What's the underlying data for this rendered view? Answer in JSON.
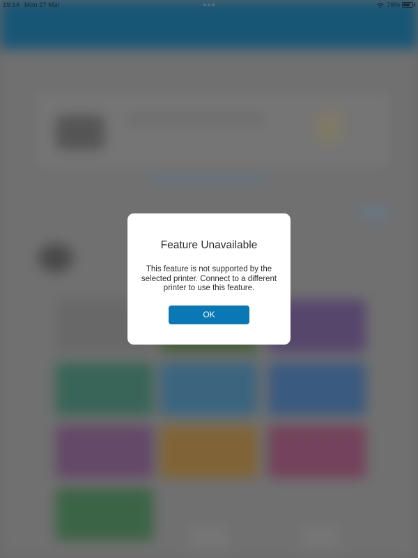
{
  "status_bar": {
    "time": "19:14",
    "date": "Mon 27 Mar",
    "battery_percent_label": "78%",
    "battery_level": 0.78,
    "wifi_icon": "wifi-icon",
    "battery_icon": "battery-icon"
  },
  "alert": {
    "title": "Feature Unavailable",
    "message": "This feature is not supported by the selected printer. Connect to a different printer to use this feature.",
    "ok_label": "OK"
  },
  "colors": {
    "accent": "#0a78b4",
    "dialog_background": "#ffffff",
    "dialog_text": "#2c2c2c",
    "app_header": "#1a5b7d"
  }
}
